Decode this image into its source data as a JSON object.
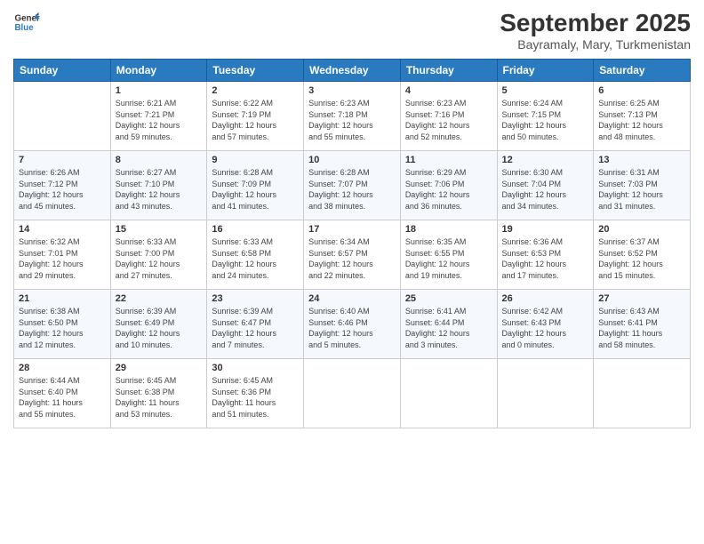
{
  "header": {
    "logo_line1": "General",
    "logo_line2": "Blue",
    "title": "September 2025",
    "subtitle": "Bayramaly, Mary, Turkmenistan"
  },
  "weekdays": [
    "Sunday",
    "Monday",
    "Tuesday",
    "Wednesday",
    "Thursday",
    "Friday",
    "Saturday"
  ],
  "weeks": [
    [
      {
        "day": "",
        "info": ""
      },
      {
        "day": "1",
        "info": "Sunrise: 6:21 AM\nSunset: 7:21 PM\nDaylight: 12 hours\nand 59 minutes."
      },
      {
        "day": "2",
        "info": "Sunrise: 6:22 AM\nSunset: 7:19 PM\nDaylight: 12 hours\nand 57 minutes."
      },
      {
        "day": "3",
        "info": "Sunrise: 6:23 AM\nSunset: 7:18 PM\nDaylight: 12 hours\nand 55 minutes."
      },
      {
        "day": "4",
        "info": "Sunrise: 6:23 AM\nSunset: 7:16 PM\nDaylight: 12 hours\nand 52 minutes."
      },
      {
        "day": "5",
        "info": "Sunrise: 6:24 AM\nSunset: 7:15 PM\nDaylight: 12 hours\nand 50 minutes."
      },
      {
        "day": "6",
        "info": "Sunrise: 6:25 AM\nSunset: 7:13 PM\nDaylight: 12 hours\nand 48 minutes."
      }
    ],
    [
      {
        "day": "7",
        "info": "Sunrise: 6:26 AM\nSunset: 7:12 PM\nDaylight: 12 hours\nand 45 minutes."
      },
      {
        "day": "8",
        "info": "Sunrise: 6:27 AM\nSunset: 7:10 PM\nDaylight: 12 hours\nand 43 minutes."
      },
      {
        "day": "9",
        "info": "Sunrise: 6:28 AM\nSunset: 7:09 PM\nDaylight: 12 hours\nand 41 minutes."
      },
      {
        "day": "10",
        "info": "Sunrise: 6:28 AM\nSunset: 7:07 PM\nDaylight: 12 hours\nand 38 minutes."
      },
      {
        "day": "11",
        "info": "Sunrise: 6:29 AM\nSunset: 7:06 PM\nDaylight: 12 hours\nand 36 minutes."
      },
      {
        "day": "12",
        "info": "Sunrise: 6:30 AM\nSunset: 7:04 PM\nDaylight: 12 hours\nand 34 minutes."
      },
      {
        "day": "13",
        "info": "Sunrise: 6:31 AM\nSunset: 7:03 PM\nDaylight: 12 hours\nand 31 minutes."
      }
    ],
    [
      {
        "day": "14",
        "info": "Sunrise: 6:32 AM\nSunset: 7:01 PM\nDaylight: 12 hours\nand 29 minutes."
      },
      {
        "day": "15",
        "info": "Sunrise: 6:33 AM\nSunset: 7:00 PM\nDaylight: 12 hours\nand 27 minutes."
      },
      {
        "day": "16",
        "info": "Sunrise: 6:33 AM\nSunset: 6:58 PM\nDaylight: 12 hours\nand 24 minutes."
      },
      {
        "day": "17",
        "info": "Sunrise: 6:34 AM\nSunset: 6:57 PM\nDaylight: 12 hours\nand 22 minutes."
      },
      {
        "day": "18",
        "info": "Sunrise: 6:35 AM\nSunset: 6:55 PM\nDaylight: 12 hours\nand 19 minutes."
      },
      {
        "day": "19",
        "info": "Sunrise: 6:36 AM\nSunset: 6:53 PM\nDaylight: 12 hours\nand 17 minutes."
      },
      {
        "day": "20",
        "info": "Sunrise: 6:37 AM\nSunset: 6:52 PM\nDaylight: 12 hours\nand 15 minutes."
      }
    ],
    [
      {
        "day": "21",
        "info": "Sunrise: 6:38 AM\nSunset: 6:50 PM\nDaylight: 12 hours\nand 12 minutes."
      },
      {
        "day": "22",
        "info": "Sunrise: 6:39 AM\nSunset: 6:49 PM\nDaylight: 12 hours\nand 10 minutes."
      },
      {
        "day": "23",
        "info": "Sunrise: 6:39 AM\nSunset: 6:47 PM\nDaylight: 12 hours\nand 7 minutes."
      },
      {
        "day": "24",
        "info": "Sunrise: 6:40 AM\nSunset: 6:46 PM\nDaylight: 12 hours\nand 5 minutes."
      },
      {
        "day": "25",
        "info": "Sunrise: 6:41 AM\nSunset: 6:44 PM\nDaylight: 12 hours\nand 3 minutes."
      },
      {
        "day": "26",
        "info": "Sunrise: 6:42 AM\nSunset: 6:43 PM\nDaylight: 12 hours\nand 0 minutes."
      },
      {
        "day": "27",
        "info": "Sunrise: 6:43 AM\nSunset: 6:41 PM\nDaylight: 11 hours\nand 58 minutes."
      }
    ],
    [
      {
        "day": "28",
        "info": "Sunrise: 6:44 AM\nSunset: 6:40 PM\nDaylight: 11 hours\nand 55 minutes."
      },
      {
        "day": "29",
        "info": "Sunrise: 6:45 AM\nSunset: 6:38 PM\nDaylight: 11 hours\nand 53 minutes."
      },
      {
        "day": "30",
        "info": "Sunrise: 6:45 AM\nSunset: 6:36 PM\nDaylight: 11 hours\nand 51 minutes."
      },
      {
        "day": "",
        "info": ""
      },
      {
        "day": "",
        "info": ""
      },
      {
        "day": "",
        "info": ""
      },
      {
        "day": "",
        "info": ""
      }
    ]
  ]
}
